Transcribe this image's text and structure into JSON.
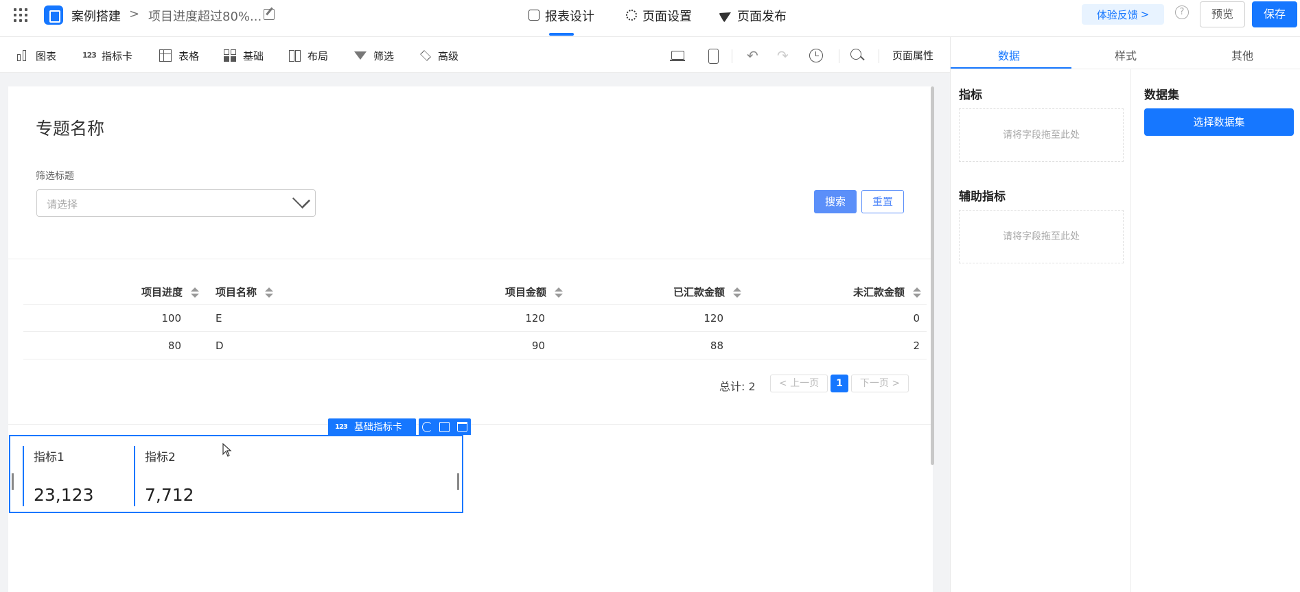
{
  "header": {
    "app_name": "案例搭建",
    "breadcrumb_sep": ">",
    "report_name": "项目进度超过80%...",
    "tabs": [
      {
        "label": "报表设计",
        "icon": "report-icon",
        "active": true
      },
      {
        "label": "页面设置",
        "icon": "gear-icon",
        "active": false
      },
      {
        "label": "页面发布",
        "icon": "send-icon",
        "active": false
      }
    ],
    "feedback_label": "体验反馈",
    "feedback_chevron": ">",
    "help_glyph": "?",
    "preview_label": "预览",
    "save_label": "保存"
  },
  "toolbar": {
    "items": [
      {
        "label": "图表",
        "icon": "bar-chart-icon"
      },
      {
        "label": "指标卡",
        "icon": "metric-card-icon",
        "glyph": "123"
      },
      {
        "label": "表格",
        "icon": "table-icon"
      },
      {
        "label": "基础",
        "icon": "basic-components-icon"
      },
      {
        "label": "布局",
        "icon": "layout-icon"
      },
      {
        "label": "筛选",
        "icon": "filter-icon"
      },
      {
        "label": "高级",
        "icon": "layers-icon"
      }
    ],
    "undo_glyph": "↶",
    "redo_glyph": "↷",
    "page_props_label": "页面属性"
  },
  "canvas": {
    "title": "专题名称",
    "filter_label": "筛选标题",
    "select_placeholder": "请选择",
    "search_label": "搜索",
    "reset_label": "重置",
    "table": {
      "columns": [
        "项目进度",
        "项目名称",
        "项目金额",
        "已汇款金额",
        "未汇款金额"
      ],
      "rows": [
        [
          "100",
          "E",
          "120",
          "120",
          "0"
        ],
        [
          "80",
          "D",
          "90",
          "88",
          "2"
        ]
      ]
    },
    "pagination": {
      "total_label": "总计: 2",
      "prev_label": "< 上一页",
      "current_page": "1",
      "next_label": "下一页 >"
    },
    "metric_card": {
      "badge_glyph": "123",
      "badge_label": "基础指标卡",
      "metrics": [
        {
          "name": "指标1",
          "value": "23,123"
        },
        {
          "name": "指标2",
          "value": "7,712"
        }
      ]
    }
  },
  "right_panel": {
    "tabs": [
      "数据",
      "样式",
      "其他"
    ],
    "active_tab": "数据",
    "indicator_title": "指标",
    "indicator_drop": "请将字段拖至此处",
    "aux_title": "辅助指标",
    "aux_drop": "请将字段拖至此处",
    "dataset_title": "数据集",
    "choose_dataset_label": "选择数据集"
  },
  "colors": {
    "primary": "#1677ff",
    "search_button": "#5b8ff9",
    "feedback_bg": "#e8f3ff"
  }
}
